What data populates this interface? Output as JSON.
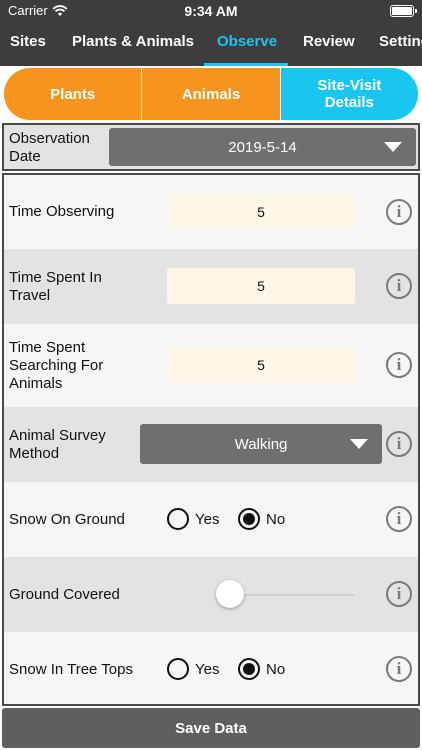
{
  "status_bar": {
    "carrier": "Carrier",
    "time": "9:34 AM"
  },
  "nav": {
    "tabs": [
      {
        "label": "Sites"
      },
      {
        "label": "Plants & Animals"
      },
      {
        "label": "Observe",
        "active": true
      },
      {
        "label": "Review"
      },
      {
        "label": "Settings"
      }
    ]
  },
  "segments": [
    {
      "label": "Plants"
    },
    {
      "label": "Animals"
    },
    {
      "label": "Site-Visit Details",
      "active": true
    }
  ],
  "observation_date": {
    "label": "Observation Date",
    "value": "2019-5-14"
  },
  "fields": {
    "time_observing": {
      "label": "Time Observing",
      "value": "5"
    },
    "time_travel": {
      "label": "Time Spent In Travel",
      "value": "5"
    },
    "time_searching": {
      "label": "Time Spent Searching For Animals",
      "value": "5"
    },
    "survey_method": {
      "label": "Animal Survey Method",
      "value": "Walking"
    },
    "snow_ground": {
      "label": "Snow On Ground",
      "yes": "Yes",
      "no": "No",
      "selected": "No"
    },
    "ground_covered": {
      "label": "Ground Covered",
      "value_fraction": 0
    },
    "snow_trees": {
      "label": "Snow In Tree Tops",
      "yes": "Yes",
      "no": "No",
      "selected": "No"
    }
  },
  "info_icon": "i",
  "save_button": "Save Data",
  "colors": {
    "header": "#3d3d3d",
    "accent_blue": "#19c6f0",
    "accent_orange": "#f7941d"
  }
}
